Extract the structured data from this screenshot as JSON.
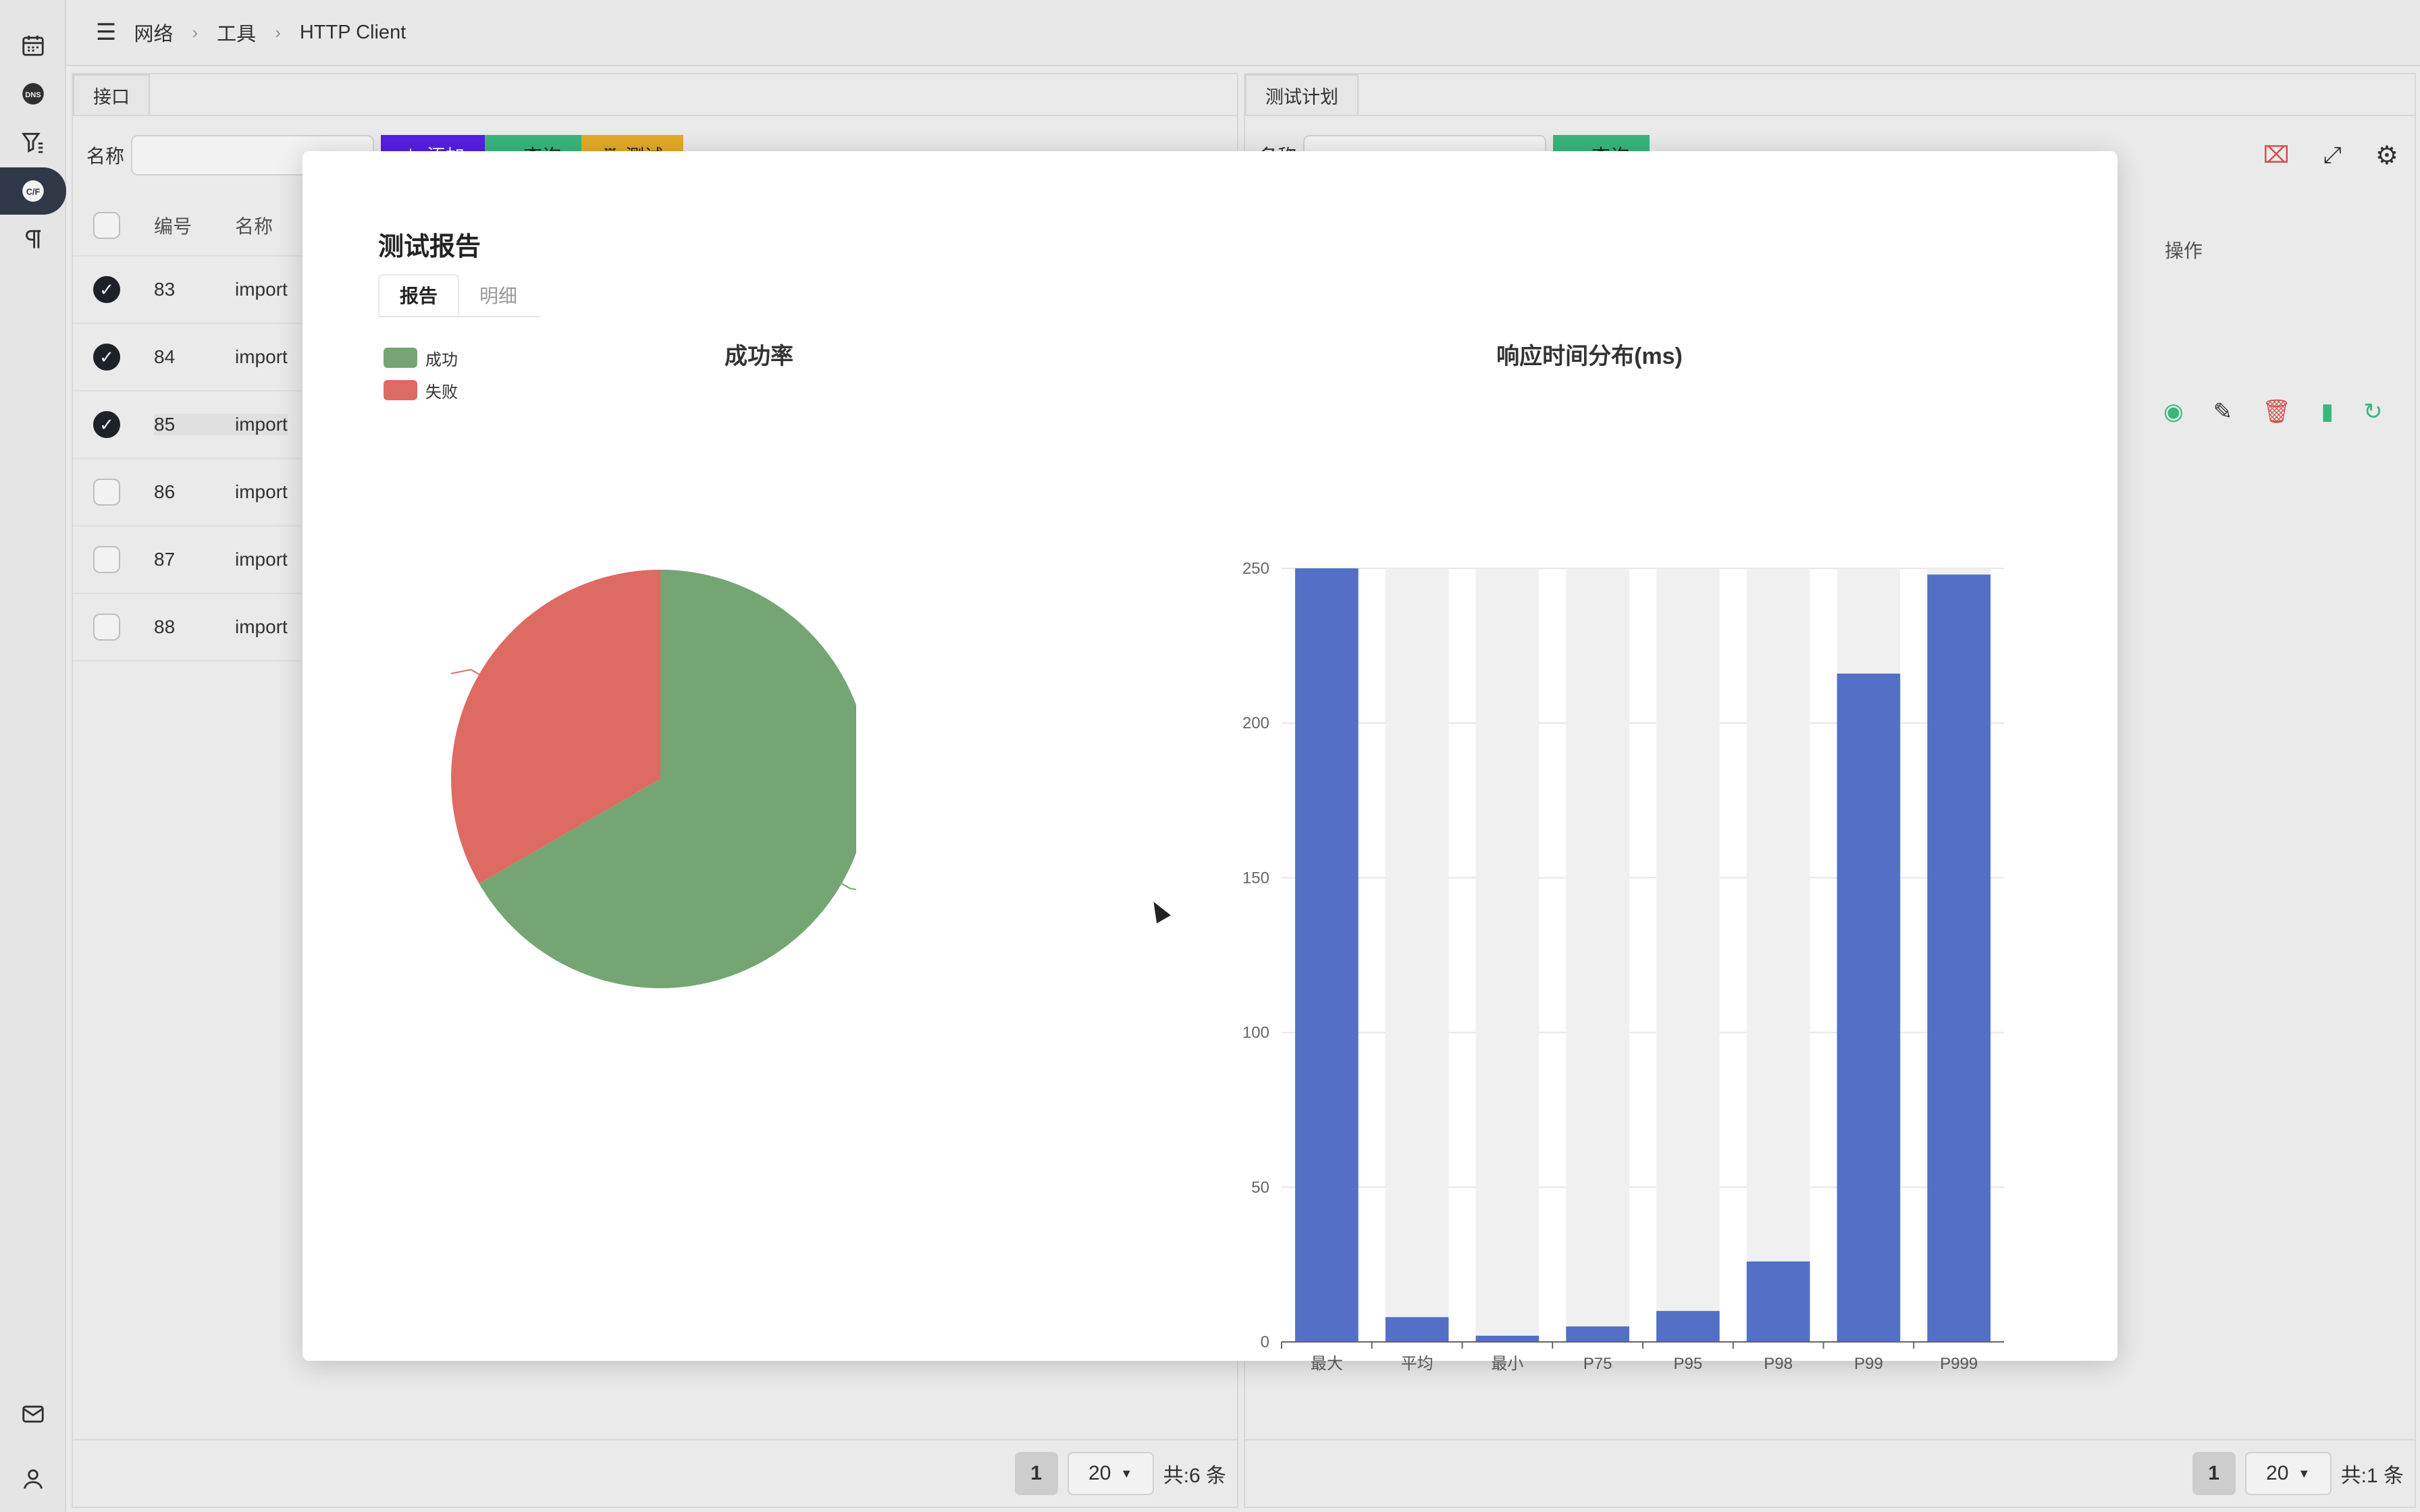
{
  "header": {
    "breadcrumb": [
      "网络",
      "工具",
      "HTTP Client"
    ]
  },
  "left_panel": {
    "tab": "接口",
    "search_label": "名称",
    "buttons": [
      "添加",
      "查询",
      "测试"
    ],
    "columns": [
      "编号",
      "名称"
    ],
    "rows": [
      {
        "id": "83",
        "name": "import",
        "checked": true
      },
      {
        "id": "84",
        "name": "import",
        "checked": true
      },
      {
        "id": "85",
        "name": "import",
        "checked": true
      },
      {
        "id": "86",
        "name": "import",
        "checked": false
      },
      {
        "id": "87",
        "name": "import",
        "checked": false
      },
      {
        "id": "88",
        "name": "import",
        "checked": false
      }
    ],
    "page": "1",
    "page_size": "20",
    "total": "共:6 条"
  },
  "right_panel": {
    "tab": "测试计划",
    "search_label": "名称",
    "buttons": [
      "查询"
    ],
    "columns": [
      "操作"
    ],
    "page": "1",
    "page_size": "20",
    "total": "共:1 条"
  },
  "modal": {
    "title": "测试报告",
    "tabs": [
      "报告",
      "明细"
    ],
    "active_tab": "报告"
  },
  "colors": {
    "success": "#74a573",
    "fail": "#de6a64",
    "bar": "#5470c6",
    "bar_bg": "#f0f0f0",
    "primary": "#5b21f0",
    "green": "#3cc085",
    "amber": "#f0b429"
  },
  "chart_data": [
    {
      "type": "pie",
      "title": "成功率",
      "legend": [
        "成功",
        "失败"
      ],
      "legend_position": "top-left",
      "slices": [
        {
          "label": "成功",
          "value": 2
        },
        {
          "label": "失败",
          "value": 1
        }
      ]
    },
    {
      "type": "bar",
      "title": "响应时间分布(ms)",
      "categories": [
        "最大",
        "平均",
        "最小",
        "P75",
        "P95",
        "P98",
        "P99",
        "P999"
      ],
      "values": [
        250,
        8,
        2,
        5,
        10,
        26,
        216,
        248
      ],
      "ylim": [
        0,
        250
      ],
      "yticks": [
        0,
        50,
        100,
        150,
        200,
        250
      ],
      "background_bars": true,
      "grid": true
    }
  ]
}
